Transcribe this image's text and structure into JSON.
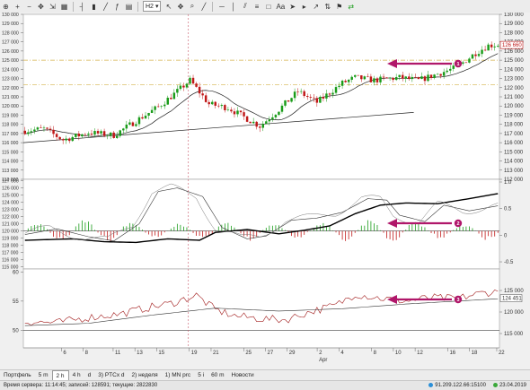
{
  "toolbar": {
    "timeframe": "H2",
    "icons": [
      "crosshair-icon",
      "zoom-in-icon",
      "zoom-out-icon",
      "hand-icon",
      "fit-icon",
      "grid-icon",
      "bar-style-icon",
      "candle-style-icon",
      "line-style-icon",
      "indicators-icon",
      "period-icon",
      "cursor-icon",
      "move-icon",
      "zoom-icon",
      "draw-line-icon",
      "hline-icon",
      "vline-icon",
      "channel-icon",
      "fibo-icon",
      "shapes-icon",
      "text-tool-icon",
      "arrow-tool-icon",
      "label-icon",
      "trend-icon",
      "arrows-icon",
      "marks-icon",
      "trade-icon"
    ],
    "text_tool_label": "Aa"
  },
  "colors": {
    "up_candle": "#1a9c1a",
    "down_candle": "#c01818",
    "hline": "#d4b24a",
    "annotation": "#b0176a",
    "cursor": "#c8586a",
    "osc_line": "#a01818"
  },
  "chart_data": [
    {
      "type": "candlestick",
      "name": "price",
      "y_ticks": [
        "130 000",
        "129 000",
        "128 000",
        "127 000",
        "126 000",
        "125 000",
        "124 000",
        "123 000",
        "122 000",
        "121 000",
        "120 000",
        "119 000",
        "118 000",
        "117 000",
        "116 000",
        "115 000",
        "114 000",
        "113 000",
        "112 000"
      ],
      "ylim": [
        112000,
        130000
      ],
      "last_price": "126 660",
      "horizontal_levels": [
        125000,
        122300
      ],
      "trendline": {
        "from": [
          0,
          116000
        ],
        "to": [
          0.82,
          119300
        ]
      },
      "moving_average": true
    },
    {
      "type": "histogram_and_lines",
      "name": "oscillator-1",
      "y_ticks_left": [
        "127 000",
        "126 000",
        "125 000",
        "124 000",
        "123 000",
        "122 000",
        "121 000",
        "120 000",
        "119 000",
        "118 000",
        "117 000",
        "116 000",
        "115 000"
      ],
      "y_ticks_right": [
        "1.0",
        "0.5",
        "0",
        "-0.5"
      ],
      "ylim": [
        114700,
        127200
      ]
    },
    {
      "type": "line",
      "name": "oscillator-2",
      "y_ticks_left": [
        "60",
        "55",
        "50"
      ],
      "y_ticks_right": [
        "125 000",
        "120 000",
        "115 000"
      ],
      "last_value": "124 451",
      "ylim_left": [
        47,
        60.5
      ]
    }
  ],
  "x_axis": {
    "labels": [
      "6",
      "8",
      "11",
      "13",
      "15",
      "19",
      "21",
      "25",
      "27",
      "29",
      "2",
      "4",
      "8",
      "10",
      "12",
      "16",
      "18",
      "22"
    ],
    "month_label": "Apr"
  },
  "annotations": [
    "1",
    "2",
    "3"
  ],
  "period_bar": {
    "tabs": [
      "Портфель",
      "5 m",
      "2 h",
      "4 h",
      "d",
      "3) PTCx d",
      "2) неделя",
      "1) MN prc",
      "5 i",
      "60 m",
      "Новости"
    ],
    "active_index": 2
  },
  "status": {
    "server_time": "Время сервера: 11:14:45; записей: 128591; текущие: 2822830",
    "ip": "91.209.122.66:15100",
    "date": "23.04.2019"
  }
}
